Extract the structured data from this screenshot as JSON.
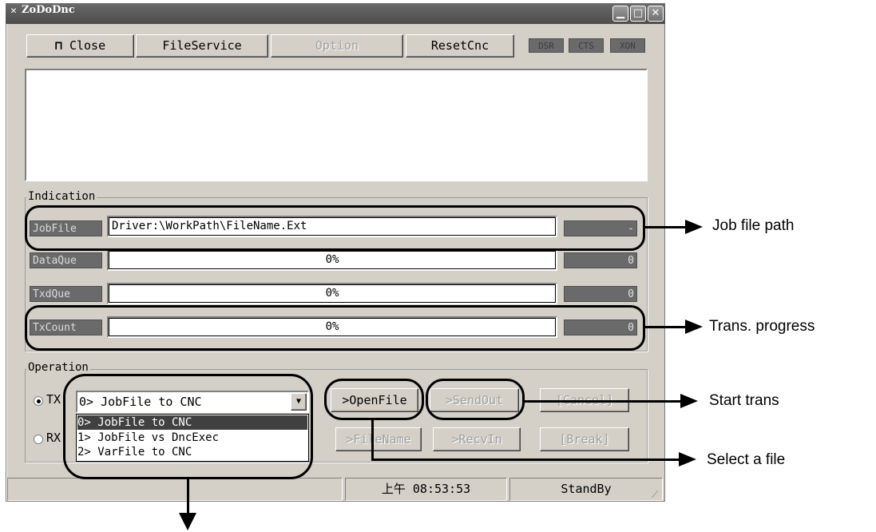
{
  "window": {
    "title": "ZoDoDnc",
    "icon": "app-icon"
  },
  "toolbar": {
    "close_label": "Close",
    "close_icon": "exit-door-icon",
    "fileservice_label": "FileService",
    "option_label": "Option",
    "resetcnc_label": "ResetCnc",
    "leds": [
      "DSR",
      "CTS",
      "XON"
    ]
  },
  "indication": {
    "title": "Indication",
    "rows": [
      {
        "label": "JobFile",
        "value": "Driver:\\WorkPath\\FileName.Ext",
        "count": "-"
      },
      {
        "label": "DataQue",
        "value": "0%",
        "count": "0"
      },
      {
        "label": "TxdQue",
        "value": "0%",
        "count": "0"
      },
      {
        "label": "TxCount",
        "value": "0%",
        "count": "0"
      }
    ]
  },
  "operation": {
    "title": "Operation",
    "tx_label": "TX",
    "rx_label": "RX",
    "tx_selected": true,
    "mode_selected": "0> JobFile to CNC",
    "mode_options": [
      "0> JobFile to CNC",
      "1> JobFile vs DncExec",
      "2> VarFile to CNC"
    ],
    "buttons_row1": [
      ">OpenFile",
      ">SendOut",
      "[Cancel]"
    ],
    "buttons_row2": [
      ">FileName",
      ">RecvIn",
      "[Break]"
    ]
  },
  "status": {
    "time": "上午 08:53:53",
    "state": "StandBy"
  },
  "annotations": {
    "job_file_path": "Job file path",
    "trans_progress": "Trans. progress",
    "start_trans": "Start trans",
    "select_file": "Select a file"
  }
}
